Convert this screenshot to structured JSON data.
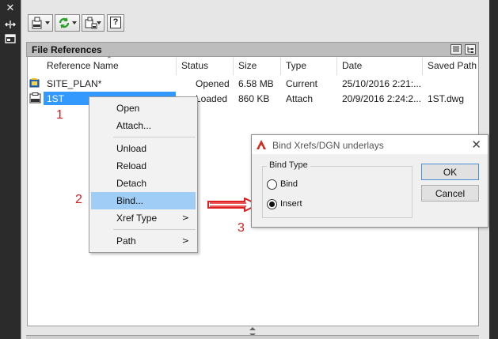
{
  "left_strip": {
    "icons": [
      "close-icon",
      "auto-hide-icon",
      "properties-icon"
    ]
  },
  "toolbar": {
    "buttons": [
      "attach-dwg-icon",
      "refresh-icon",
      "change-path-icon",
      "help-icon"
    ],
    "help_glyph": "?"
  },
  "file_references": {
    "title": "File References",
    "columns": [
      "Reference Name",
      "Status",
      "Size",
      "Type",
      "Date",
      "Saved Path"
    ],
    "rows": [
      {
        "name": "SITE_PLAN*",
        "status": "Opened",
        "size": "6.58 MB",
        "type": "Current",
        "date": "25/10/2016 2:21:...",
        "saved_path": ""
      },
      {
        "name": "1ST",
        "status": "Loaded",
        "size": "860 KB",
        "type": "Attach",
        "date": "20/9/2016 2:24:2...",
        "saved_path": "1ST.dwg"
      }
    ]
  },
  "annotations": {
    "step1": "1",
    "step2": "2",
    "step3": "3"
  },
  "context_menu": {
    "items": [
      {
        "label": "Open",
        "submenu": false
      },
      {
        "label": "Attach...",
        "submenu": false
      },
      {
        "label": "Unload",
        "submenu": false
      },
      {
        "label": "Reload",
        "submenu": false
      },
      {
        "label": "Detach",
        "submenu": false
      },
      {
        "label": "Bind...",
        "submenu": false,
        "highlighted": true
      },
      {
        "label": "Xref Type",
        "submenu": true
      },
      {
        "label": "Path",
        "submenu": true
      }
    ],
    "submenu_arrow": ">"
  },
  "dialog": {
    "title": "Bind Xrefs/DGN underlays",
    "close": "✕",
    "group_label": "Bind Type",
    "options": [
      {
        "label": "Bind",
        "selected": false
      },
      {
        "label": "Insert",
        "selected": true
      }
    ],
    "ok": "OK",
    "cancel": "Cancel"
  },
  "colors": {
    "selection": "#3399ff",
    "menu_highlight": "#9fcdf5",
    "annotation_red": "#d22020",
    "arrow_red": "#e02020"
  }
}
